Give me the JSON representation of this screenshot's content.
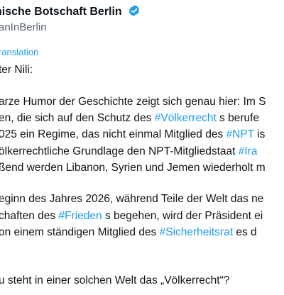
{
  "account": {
    "name": "nische Botschaft Berlin",
    "handle": "anInBerlin",
    "verified_color": "#1d9bf0"
  },
  "translation_label": "ranslation",
  "colors": {
    "text": "#0f1419",
    "secondary": "#536471",
    "link": "#1d9bf0"
  },
  "lines": [
    {
      "segments": [
        {
          "text": "ter Nili:"
        }
      ]
    },
    {
      "segments": [
        {
          "text": "arze Humor der Geschichte zeigt sich genau hier: Im S"
        }
      ]
    },
    {
      "segments": [
        {
          "text": "en, die sich auf den Schutz des "
        },
        {
          "text": "#Völkerrecht",
          "link": true
        },
        {
          "text": " s berufe"
        }
      ]
    },
    {
      "segments": [
        {
          "text": "025 ein Regime, das nicht einmal Mitglied des "
        },
        {
          "text": "#NPT",
          "link": true
        },
        {
          "text": " is"
        }
      ]
    },
    {
      "segments": [
        {
          "text": "ölkerrechtliche Grundlage den NPT-Mitgliedstaat "
        },
        {
          "text": "#Ira",
          "link": true
        }
      ]
    },
    {
      "segments": [
        {
          "text": "ßend werden Libanon, Syrien und Jemen wiederholt m"
        }
      ]
    },
    {
      "segments": [
        {
          "text": "eginn des Jahres 2026, während Teile der Welt das ne"
        }
      ]
    },
    {
      "segments": [
        {
          "text": "chaften des "
        },
        {
          "text": "#Frieden",
          "link": true
        },
        {
          "text": " s begehen, wird der Präsident ei"
        }
      ]
    },
    {
      "segments": [
        {
          "text": "on einem ständigen Mitglied des "
        },
        {
          "text": "#Sicherheitsrat",
          "link": true
        },
        {
          "text": " es d"
        }
      ]
    },
    {
      "segments": [
        {
          "text": "u steht in einer solchen Welt das „Völkerrecht“?"
        }
      ]
    }
  ]
}
